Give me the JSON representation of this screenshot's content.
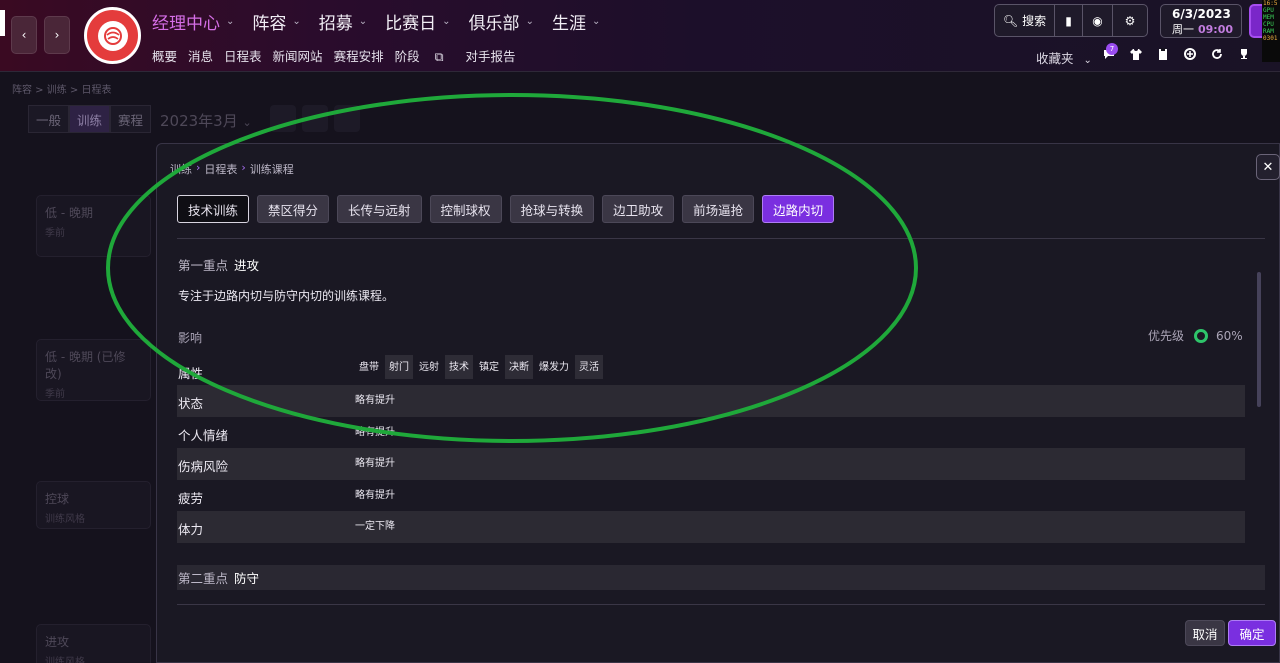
{
  "header": {
    "main_nav": [
      {
        "label": "经理中心",
        "active": true
      },
      {
        "label": "阵容",
        "active": false
      },
      {
        "label": "招募",
        "active": false
      },
      {
        "label": "比赛日",
        "active": false
      },
      {
        "label": "俱乐部",
        "active": false
      },
      {
        "label": "生涯",
        "active": false
      }
    ],
    "sub_nav": [
      "概要",
      "消息",
      "日程表",
      "新闻网站",
      "赛程安排",
      "阶段",
      "对手报告"
    ],
    "search_label": "搜索",
    "date": "6/3/2023",
    "weekday": "周一",
    "time": "09:00",
    "favorites_label": "收藏夹",
    "message_count": "7",
    "monitor_lines": [
      "16:5",
      "GPU",
      "MEM",
      "CPU",
      "RAM",
      "0301"
    ]
  },
  "background": {
    "breadcrumb": "阵容 > 训练 > 日程表",
    "tabs": [
      "一般",
      "训练",
      "赛程"
    ],
    "month": "2023年3月",
    "cards": [
      {
        "title": "低 - 晚期",
        "sub": "季前"
      },
      {
        "title": "低 - 晚期 (已修改)",
        "sub": "季前"
      },
      {
        "title": "控球",
        "sub": "训练风格"
      },
      {
        "title": "进攻",
        "sub": "训练风格"
      }
    ]
  },
  "modal": {
    "breadcrumb": [
      "训练",
      "日程表",
      "训练课程"
    ],
    "tabs": [
      "技术训练",
      "禁区得分",
      "长传与远射",
      "控制球权",
      "抢球与转换",
      "边卫助攻",
      "前场逼抢",
      "边路内切"
    ],
    "selected_tab": "边路内切",
    "focus1_label": "第一重点",
    "focus1_value": "进攻",
    "description": "专注于边路内切与防守内切的训练课程。",
    "impact_label": "影响",
    "priority_label": "优先级",
    "priority_value": "60%",
    "priority_fraction": 0.6,
    "attributes_label": "属性",
    "attributes": [
      "盘带",
      "射门",
      "远射",
      "技术",
      "镇定",
      "决断",
      "爆发力",
      "灵活"
    ],
    "rows": [
      {
        "label": "状态",
        "value": "略有提升"
      },
      {
        "label": "个人情绪",
        "value": "略有提升"
      },
      {
        "label": "伤病风险",
        "value": "略有提升"
      },
      {
        "label": "疲劳",
        "value": "略有提升"
      },
      {
        "label": "体力",
        "value": "一定下降"
      }
    ],
    "focus2_label": "第二重点",
    "focus2_value": "防守",
    "cancel_label": "取消",
    "ok_label": "确定"
  },
  "colors": {
    "accent": "#7a2fe0",
    "annotation": "#1fa83a",
    "priority": "#2ec46a"
  }
}
